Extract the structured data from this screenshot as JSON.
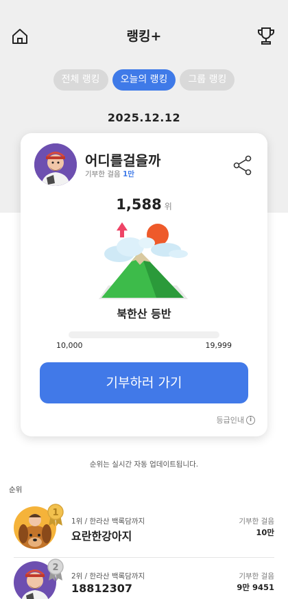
{
  "header": {
    "title": "랭킹+",
    "home_icon": "home-icon",
    "trophy_icon": "trophy-icon"
  },
  "tabs": [
    {
      "label": "전체 랭킹",
      "active": false
    },
    {
      "label": "오늘의 랭킹",
      "active": true
    },
    {
      "label": "그룹 랭킹",
      "active": false
    }
  ],
  "date": "2025.12.12",
  "card": {
    "nickname": "어디를걸을까",
    "donated_label": "기부한 걸음",
    "donated_value": "1만",
    "rank_number": "1,588",
    "rank_unit": "위",
    "mountain_name": "북한산 등반",
    "range_min": "10,000",
    "range_max": "19,999",
    "progress_fraction": 0,
    "donate_button": "기부하러 가기",
    "grade_guide": "등급인내",
    "share_icon": "share-icon",
    "accent": "#3f7ae8"
  },
  "notice": "순위는 실시간 자동 업데이트됩니다.",
  "section_label": "순위",
  "ranking": [
    {
      "rank_info": "1위 / 한라산 백록담까지",
      "name": "요란한강아지",
      "amount_label": "기부한 걸음",
      "amount": "10만",
      "medal": "gold"
    },
    {
      "rank_info": "2위 / 한라산 백록담까지",
      "name": "18812307",
      "amount_label": "기부한 걸음",
      "amount": "9만 9451",
      "medal": "silver"
    }
  ]
}
